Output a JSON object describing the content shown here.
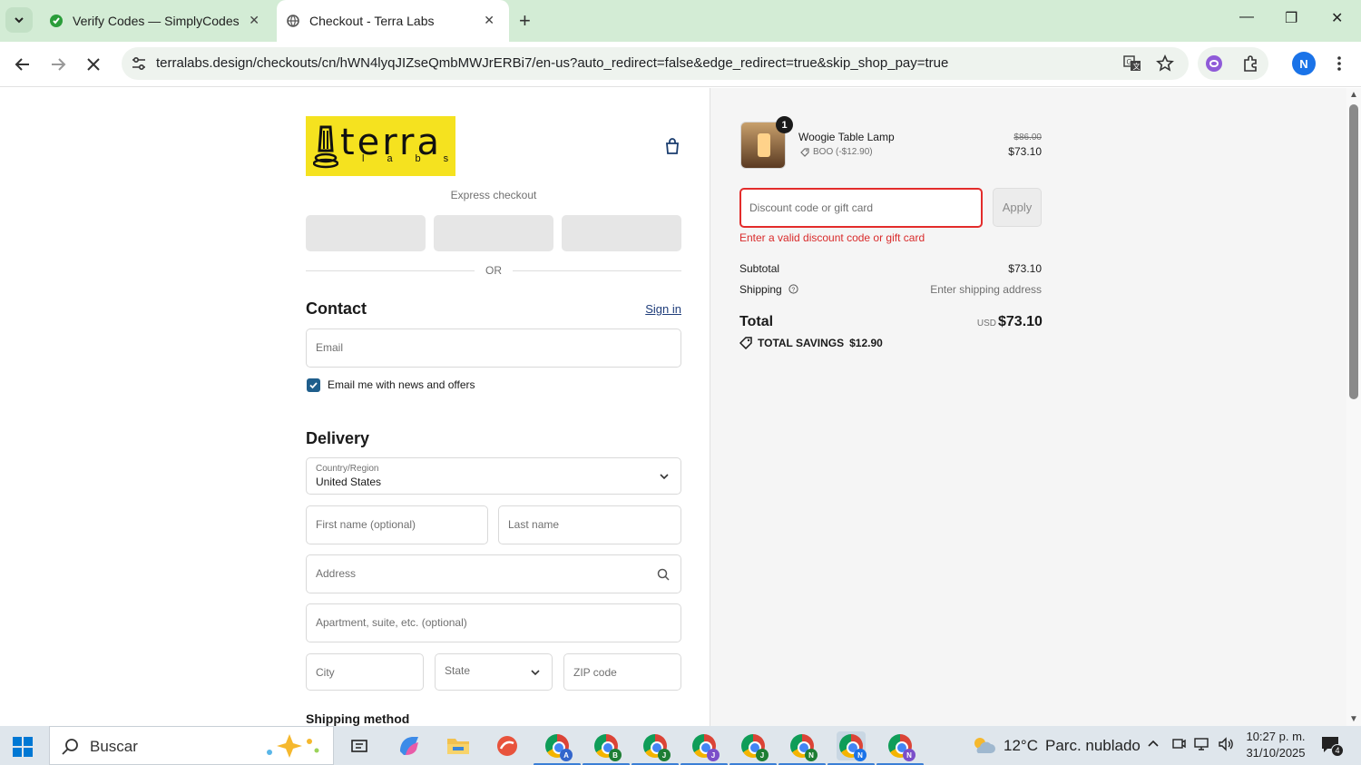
{
  "browser": {
    "tabs": [
      {
        "title": "Verify Codes — SimplyCodes",
        "active": false
      },
      {
        "title": "Checkout - Terra Labs",
        "active": true
      }
    ],
    "url": "terralabs.design/checkouts/cn/hWN4lyqJIZseQmbMWJrERBi7/en-us?auto_redirect=false&edge_redirect=true&skip_shop_pay=true",
    "profile_initial": "N"
  },
  "checkout": {
    "logo": {
      "word": "terra",
      "sub": "labs"
    },
    "express_label": "Express checkout",
    "or_label": "OR",
    "contact": {
      "heading": "Contact",
      "signin_label": "Sign in",
      "email_placeholder": "Email",
      "newsletter_label": "Email me with news and offers",
      "newsletter_checked": true
    },
    "delivery": {
      "heading": "Delivery",
      "country_label": "Country/Region",
      "country_value": "United States",
      "first_name_placeholder": "First name (optional)",
      "last_name_placeholder": "Last name",
      "address_placeholder": "Address",
      "apartment_placeholder": "Apartment, suite, etc. (optional)",
      "city_placeholder": "City",
      "state_placeholder": "State",
      "zip_placeholder": "ZIP code"
    },
    "shipping_method_heading": "Shipping method"
  },
  "summary": {
    "item": {
      "quantity": "1",
      "name": "Woogie Table Lamp",
      "discount": "BOO (-$12.90)",
      "original_price": "$86.00",
      "price": "$73.10"
    },
    "discount_placeholder": "Discount code or gift card",
    "apply_label": "Apply",
    "discount_error": "Enter a valid discount code or gift card",
    "subtotal_label": "Subtotal",
    "subtotal_value": "$73.10",
    "shipping_label": "Shipping",
    "shipping_value": "Enter shipping address",
    "total_label": "Total",
    "total_currency": "USD",
    "total_value": "$73.10",
    "savings_label": "TOTAL SAVINGS",
    "savings_value": "$12.90"
  },
  "taskbar": {
    "search_label": "Buscar",
    "chrome_badges": [
      "A",
      "B",
      "J",
      "J",
      "J",
      "N",
      "N",
      "N"
    ],
    "weather_temp": "12°C",
    "weather_desc": "Parc. nublado",
    "time": "10:27 p. m.",
    "date": "31/10/2025",
    "notification_count": "4"
  },
  "colors": {
    "tabbar": "#d3ecd5",
    "logo_yellow": "#f5e21f",
    "error_red": "#d92b2b",
    "checkbox_blue": "#1f5e8c"
  }
}
